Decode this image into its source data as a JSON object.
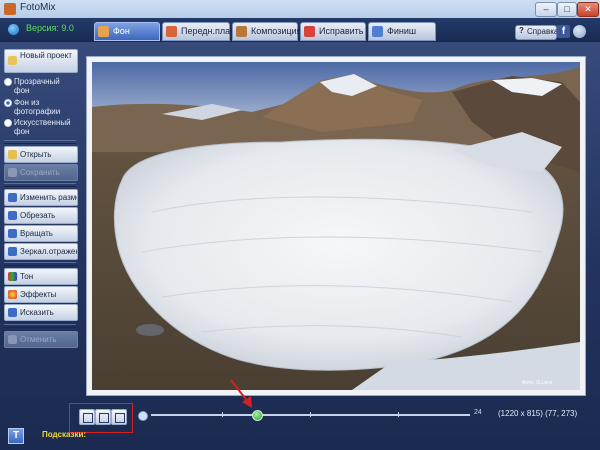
{
  "window": {
    "title": "FotoMix",
    "controls": [
      "–",
      "□",
      "✕"
    ]
  },
  "header": {
    "version": "Версия: 9.0",
    "tabs": [
      {
        "label": "Фон",
        "icon": "background-icon",
        "active": true
      },
      {
        "label": "Передн.план",
        "icon": "foreground-icon",
        "active": false
      },
      {
        "label": "Композиция",
        "icon": "composition-icon",
        "active": false
      },
      {
        "label": "Исправить",
        "icon": "fix-icon",
        "active": false
      },
      {
        "label": "Финиш",
        "icon": "finish-icon",
        "active": false
      }
    ],
    "help_label": "Справка",
    "facebook_label": "f"
  },
  "sidebar": {
    "new_project": "Новый проект",
    "radios": [
      {
        "label": "Прозрачный фон",
        "checked": false
      },
      {
        "label": "Фон из фотографии",
        "checked": true
      },
      {
        "label": "Искусственный фон",
        "checked": false
      }
    ],
    "open": "Открыть",
    "save": "Сохранить",
    "tools": [
      {
        "label": "Изменить размер",
        "icon": "resize-icon"
      },
      {
        "label": "Обрезать",
        "icon": "crop-icon"
      },
      {
        "label": "Вращать",
        "icon": "rotate-icon"
      },
      {
        "label": "Зеркал.отражение",
        "icon": "mirror-icon"
      }
    ],
    "effects": [
      {
        "label": "Тон",
        "icon": "tone-icon"
      },
      {
        "label": "Эффекты",
        "icon": "effects-icon"
      },
      {
        "label": "Исказить",
        "icon": "distort-icon"
      }
    ],
    "undo": "Отменить"
  },
  "canvas": {
    "watermark": "Фото: G.Lenz"
  },
  "bottom": {
    "zoom_value": "24",
    "zoom_level": 0.33,
    "image_info": "(1220 x 815)  (77, 273)",
    "hints_label": "Подсказки:",
    "info_icon": "T"
  },
  "colors": {
    "accent": "#3e66bb",
    "hint_text": "#f2dc3a",
    "version_text": "#55e05a",
    "highlight": "#d42222"
  }
}
